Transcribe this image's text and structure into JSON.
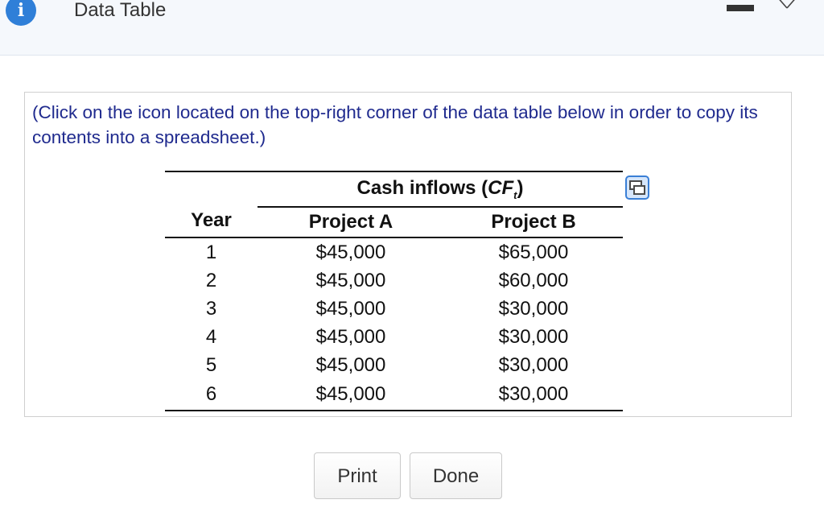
{
  "window": {
    "title": "Data Table",
    "info_icon": "i"
  },
  "instructions": "(Click on the icon located on the top-right corner of the data table below in order to copy its contents into a spreadsheet.)",
  "table": {
    "group_header_main": "Cash inflows (",
    "group_header_symbol": "CF",
    "group_header_sub": "t",
    "group_header_close": ")",
    "year_header": "Year",
    "columns": [
      "Project A",
      "Project B"
    ],
    "rows": [
      {
        "year": "1",
        "a": "$45,000",
        "b": "$65,000"
      },
      {
        "year": "2",
        "a": "$45,000",
        "b": "$60,000"
      },
      {
        "year": "3",
        "a": "$45,000",
        "b": "$30,000"
      },
      {
        "year": "4",
        "a": "$45,000",
        "b": "$30,000"
      },
      {
        "year": "5",
        "a": "$45,000",
        "b": "$30,000"
      },
      {
        "year": "6",
        "a": "$45,000",
        "b": "$30,000"
      }
    ]
  },
  "buttons": {
    "print": "Print",
    "done": "Done"
  },
  "colors": {
    "accent": "#2f7fd8",
    "instruction_text": "#1f2a8e"
  }
}
